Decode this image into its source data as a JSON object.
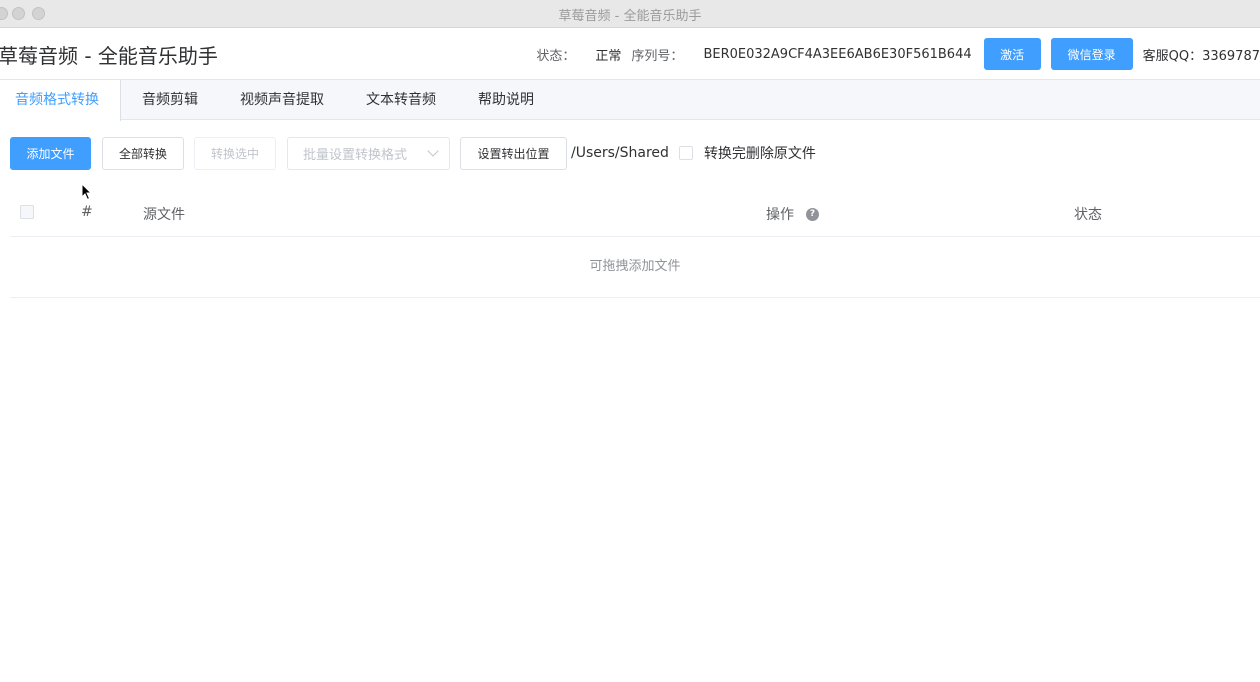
{
  "window": {
    "title": "草莓音频 - 全能音乐助手"
  },
  "header": {
    "app_title": "草莓音频 - 全能音乐助手",
    "status_label": "状态：",
    "status_value": "正常",
    "serial_label": "序列号：",
    "serial_value": "BER0E032A9CF4A3EE6AB6E30F561B644",
    "activate_button": "激活",
    "wechat_login_button": "微信登录",
    "qq_text": "客服QQ：3369787"
  },
  "tabs": [
    {
      "label": "音频格式转换",
      "active": true
    },
    {
      "label": "音频剪辑",
      "active": false
    },
    {
      "label": "视频声音提取",
      "active": false
    },
    {
      "label": "文本转音频",
      "active": false
    },
    {
      "label": "帮助说明",
      "active": false
    }
  ],
  "toolbar": {
    "add_file": "添加文件",
    "convert_all": "全部转换",
    "convert_selected": "转换选中",
    "batch_format_placeholder": "批量设置转换格式",
    "set_output": "设置转出位置",
    "output_path": "/Users/Shared",
    "delete_original_label": "转换完删除原文件"
  },
  "table": {
    "columns": {
      "index": "#",
      "source": "源文件",
      "operation": "操作",
      "status": "状态"
    },
    "empty_text": "可拖拽添加文件"
  },
  "icons": {
    "help": "help-icon",
    "cursor": "mouse-pointer-icon",
    "dropdown": "chevron-down-icon"
  },
  "colors": {
    "accent": "#409eff"
  }
}
